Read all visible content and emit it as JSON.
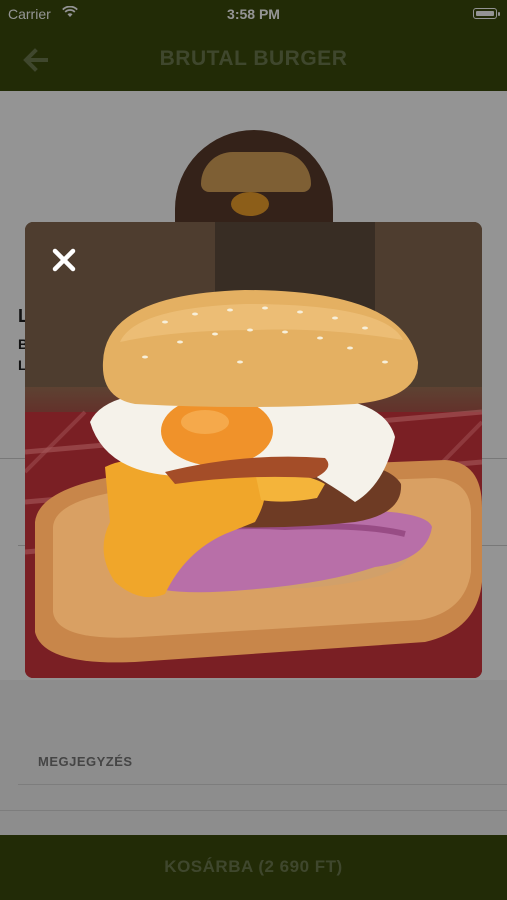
{
  "status_bar": {
    "carrier": "Carrier",
    "time": "3:58 PM"
  },
  "nav": {
    "title": "BRUTAL BURGER",
    "back_icon": "arrow-left-icon"
  },
  "content": {
    "fragment_l": "L",
    "fragment_b": "B",
    "fragment_l2": "L",
    "note_label": "MEGJEGYZÉS"
  },
  "cart": {
    "label": "KOSÁRBA (2 690 FT)"
  },
  "modal": {
    "close_icon": "close-icon",
    "image": "burger-photo"
  },
  "colors": {
    "brand": "#3b4a0c",
    "brand_text": "#6d7a4f"
  }
}
